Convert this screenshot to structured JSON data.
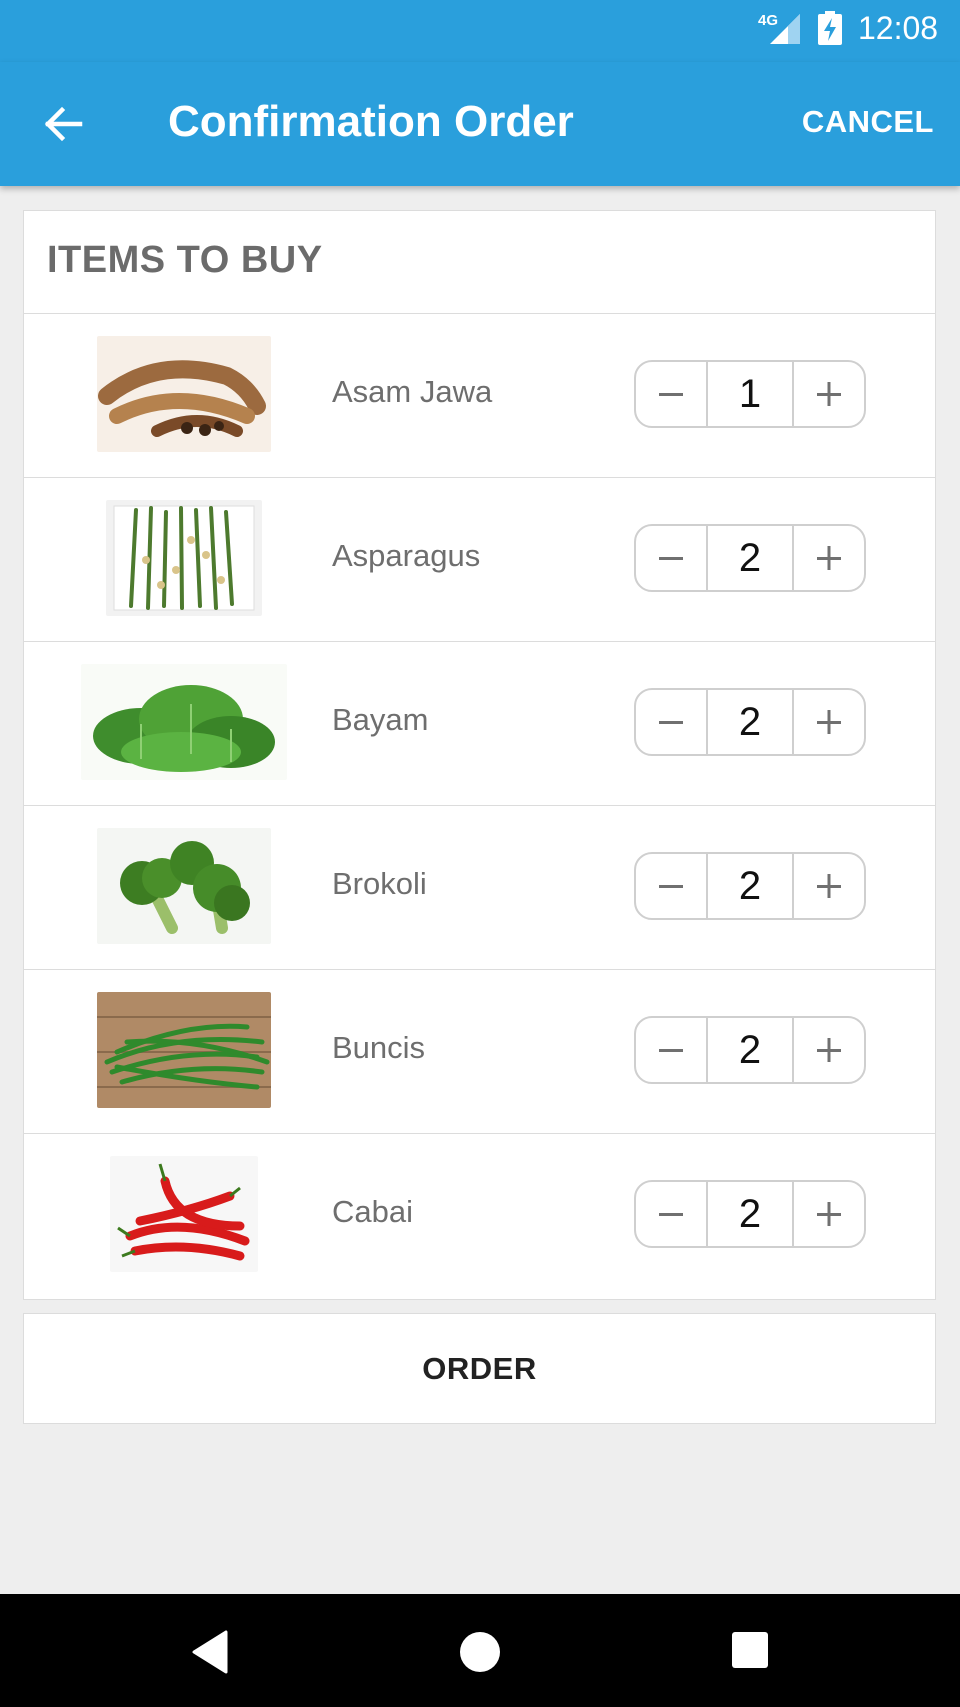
{
  "status_bar": {
    "network": "4G",
    "time": "12:08"
  },
  "app_bar": {
    "title": "Confirmation Order",
    "cancel_label": "CANCEL"
  },
  "card": {
    "title": "ITEMS TO BUY"
  },
  "items": [
    {
      "name": "Asam Jawa",
      "quantity": "1",
      "minus": "−",
      "plus": "+"
    },
    {
      "name": "Asparagus",
      "quantity": "2",
      "minus": "−",
      "plus": "+"
    },
    {
      "name": "Bayam",
      "quantity": "2",
      "minus": "−",
      "plus": "+"
    },
    {
      "name": "Brokoli",
      "quantity": "2",
      "minus": "−",
      "plus": "+"
    },
    {
      "name": "Buncis",
      "quantity": "2",
      "minus": "−",
      "plus": "+"
    },
    {
      "name": "Cabai",
      "quantity": "2",
      "minus": "−",
      "plus": "+"
    }
  ],
  "order_label": "ORDER",
  "colors": {
    "primary": "#2a9fdc",
    "background": "#eeeeee",
    "navbar": "#000000"
  },
  "icons": {
    "back": "arrow-left-icon",
    "signal": "signal-icon",
    "battery": "battery-charging-icon",
    "nav_back": "nav-back-icon",
    "nav_home": "nav-home-icon",
    "nav_recents": "nav-recents-icon"
  }
}
